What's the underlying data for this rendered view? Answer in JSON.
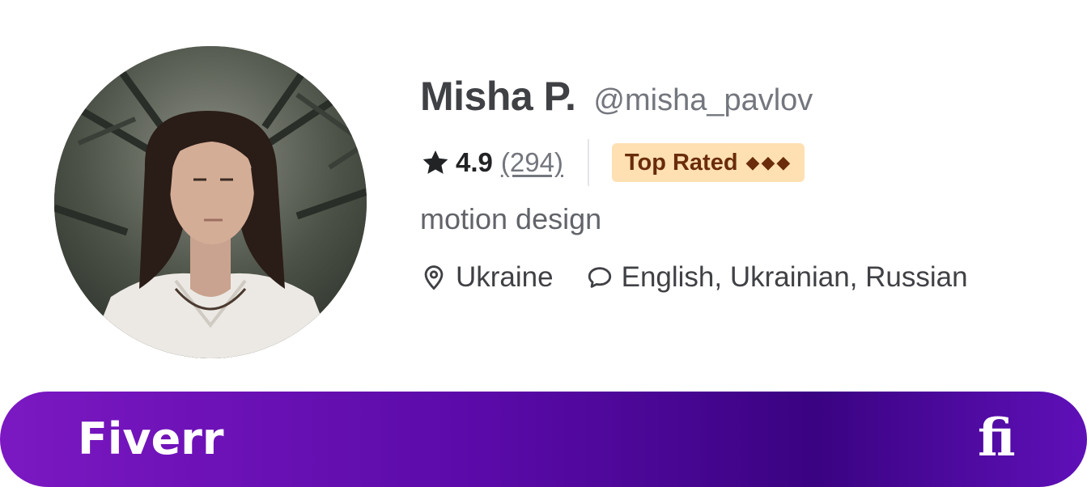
{
  "profile": {
    "name": "Misha P.",
    "handle": "@misha_pavlov",
    "rating": "4.9",
    "review_count": "(294)",
    "badge": "Top Rated",
    "badge_diamonds": "◆◆◆",
    "tagline": "motion design",
    "location": "Ukraine",
    "languages": "English, Ukrainian, Russian"
  },
  "footer": {
    "brand": "Fiverr",
    "logo": "fi"
  },
  "icons": {
    "rating": "star-icon",
    "location": "map-pin-icon",
    "languages": "speech-bubble-icon"
  },
  "colors": {
    "name": "#404145",
    "handle": "#74767e",
    "badge_bg": "#ffe0b3",
    "badge_text": "#6a2c0a",
    "footer_gradient_start": "#7b18c2",
    "footer_gradient_end": "#3a0382"
  }
}
